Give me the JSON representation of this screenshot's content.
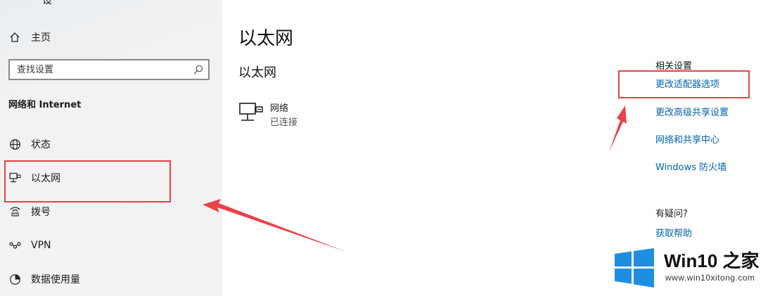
{
  "sidebar": {
    "top_partial_label": "设",
    "home_label": "主页",
    "search_placeholder": "查找设置",
    "section_title": "网络和 Internet",
    "items": [
      {
        "label": "状态",
        "icon": "globe-icon"
      },
      {
        "label": "以太网",
        "icon": "ethernet-icon"
      },
      {
        "label": "拨号",
        "icon": "dialup-icon"
      },
      {
        "label": "VPN",
        "icon": "vpn-icon"
      },
      {
        "label": "数据使用量",
        "icon": "data-usage-icon"
      }
    ]
  },
  "main": {
    "title": "以太网",
    "subtitle": "以太网",
    "network": {
      "name": "网络",
      "status": "已连接",
      "icon": "ethernet-network-icon"
    }
  },
  "related": {
    "header": "相关设置",
    "links": [
      "更改适配器选项",
      "更改高级共享设置",
      "网络和共享中心",
      "Windows 防火墙"
    ],
    "help_header": "有疑问?",
    "help_link": "获取帮助"
  },
  "watermark": {
    "brand": "Win10 之家",
    "url": "www.win10xitong.com"
  },
  "colors": {
    "link": "#0063b1",
    "annotation": "#e84149",
    "sidebar_bg": "#f2f2f2",
    "win_blue": "#1e8fe0"
  }
}
